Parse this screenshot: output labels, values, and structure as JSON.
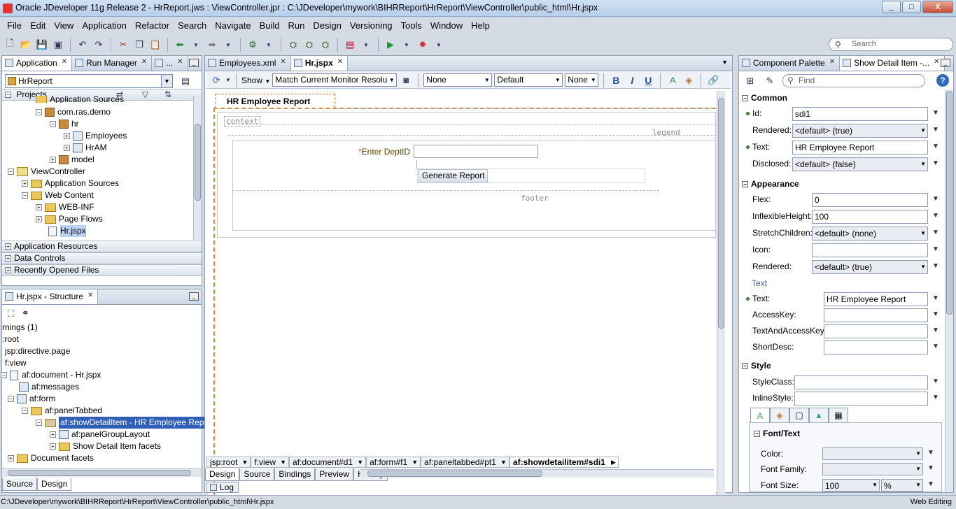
{
  "window": {
    "title": "Oracle JDeveloper 11g Release 2 - HrReport.jws : ViewController.jpr : C:\\JDeveloper\\mywork\\BIHRReport\\HrReport\\ViewController\\public_html\\Hr.jspx",
    "minimize": "_",
    "maximize": "□",
    "close": "X"
  },
  "menu": [
    "File",
    "Edit",
    "View",
    "Application",
    "Refactor",
    "Search",
    "Navigate",
    "Build",
    "Run",
    "Design",
    "Versioning",
    "Tools",
    "Window",
    "Help"
  ],
  "global_search": {
    "placeholder": "Search"
  },
  "left_top": {
    "tabs": [
      {
        "label": "Application",
        "close": "✕"
      },
      {
        "label": "Run Manager",
        "close": "✕"
      },
      {
        "label": "...",
        "close": "✕"
      }
    ],
    "app_combo": "HrReport",
    "projects_label": "Projects",
    "tree": [
      {
        "label": "Application Sources"
      },
      {
        "label": "com.ras.demo"
      },
      {
        "label": "hr"
      },
      {
        "label": "Employees"
      },
      {
        "label": "HrAM"
      },
      {
        "label": "model"
      },
      {
        "label": "ViewController"
      },
      {
        "label": "Application Sources"
      },
      {
        "label": "Web Content"
      },
      {
        "label": "WEB-INF"
      },
      {
        "label": "Page Flows"
      },
      {
        "label": "Hr.jspx"
      }
    ],
    "accordions": [
      "Application Resources",
      "Data Controls",
      "Recently Opened Files"
    ]
  },
  "structure": {
    "tab": "Hr.jspx - Structure",
    "tab_close": "✕",
    "tree": [
      {
        "label": "rnings (1)"
      },
      {
        "label": ":root"
      },
      {
        "label": "jsp:directive.page"
      },
      {
        "label": "f:view"
      },
      {
        "label": "af:document - Hr.jspx"
      },
      {
        "label": "af:messages"
      },
      {
        "label": "af:form"
      },
      {
        "label": "af:panelTabbed"
      },
      {
        "label": "af:showDetailItem - HR Employee Report"
      },
      {
        "label": "af:panelGroupLayout"
      },
      {
        "label": "Show Detail Item facets"
      },
      {
        "label": "Document facets"
      }
    ],
    "bottom_tabs": [
      "Source",
      "Design"
    ]
  },
  "editor": {
    "tabs": [
      {
        "label": "Employees.xml",
        "close": "✕"
      },
      {
        "label": "Hr.jspx",
        "close": "✕"
      }
    ],
    "toolbar": {
      "show": "Show",
      "resolution": "Match Current Monitor Resolution",
      "style1": "None",
      "style2": "Default",
      "style3": "None",
      "bold": "B",
      "italic": "I",
      "underline": "U"
    },
    "canvas": {
      "tab_title": "HR Employee Report",
      "context": "context",
      "legend": "legend",
      "footer": "footer",
      "field_required": "*",
      "field_label": "Enter DeptID",
      "button": "Generate Report"
    },
    "breadcrumb": [
      "jsp:root",
      "f:view",
      "af:document#d1",
      "af:form#f1",
      "af:paneltabbed#pt1",
      "af:showdetailitem#sdi1"
    ],
    "bottom_tabs": [
      "Design",
      "Source",
      "Bindings",
      "Preview",
      "History"
    ],
    "log_tab": "Log"
  },
  "inspector": {
    "tabs": [
      {
        "label": "Component Palette",
        "close": "✕"
      },
      {
        "label": "Show Detail Item -...",
        "close": "✕"
      }
    ],
    "find_placeholder": "Find",
    "sections": {
      "common": "Common",
      "appearance": "Appearance",
      "text_sub": "Text",
      "style": "Style",
      "font_text": "Font/Text"
    },
    "common": [
      {
        "label": "Id:",
        "value": "sdi1",
        "dot": true
      },
      {
        "label": "Rendered:",
        "value": "<default> (true)"
      },
      {
        "label": "Text:",
        "value": "HR Employee Report",
        "dot": true
      },
      {
        "label": "Disclosed:",
        "value": "<default> (false)"
      }
    ],
    "appearance": [
      {
        "label": "Flex:",
        "value": "0"
      },
      {
        "label": "InflexibleHeight:",
        "value": "100"
      },
      {
        "label": "StretchChildren:",
        "value": "<default> (none)"
      },
      {
        "label": "Icon:",
        "value": ""
      },
      {
        "label": "Rendered:",
        "value": "<default> (true)"
      }
    ],
    "text": [
      {
        "label": "Text:",
        "value": "HR Employee Report",
        "dot": true
      },
      {
        "label": "AccessKey:",
        "value": ""
      },
      {
        "label": "TextAndAccessKey:",
        "value": ""
      },
      {
        "label": "ShortDesc:",
        "value": ""
      }
    ],
    "style": [
      {
        "label": "StyleClass:",
        "value": ""
      },
      {
        "label": "InlineStyle:",
        "value": ""
      }
    ],
    "font": [
      {
        "label": "Color:",
        "value": ""
      },
      {
        "label": "Font Family:",
        "value": ""
      },
      {
        "label": "Font Size:",
        "value": "100",
        "unit": "%"
      }
    ]
  },
  "status": {
    "path": "C:\\JDeveloper\\mywork\\BIHRReport\\HrReport\\ViewController\\public_html\\Hr.jspx",
    "mode": "Web Editing"
  },
  "colors": {
    "accent": "#2f5fb8",
    "dash": "#e0883e"
  }
}
